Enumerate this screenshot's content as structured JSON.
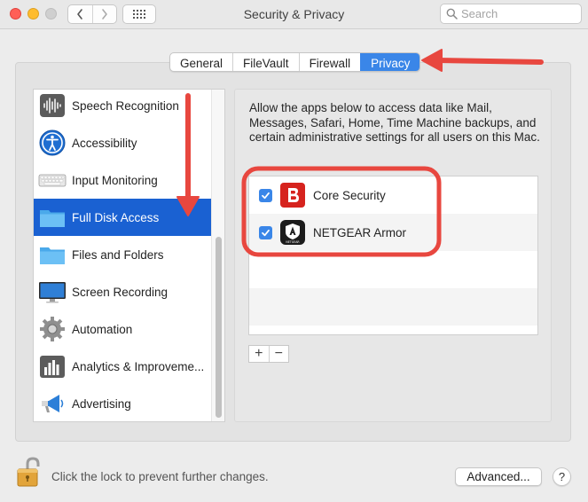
{
  "window": {
    "title": "Security & Privacy",
    "search_placeholder": "Search"
  },
  "tabs": [
    {
      "label": "General",
      "active": false
    },
    {
      "label": "FileVault",
      "active": false
    },
    {
      "label": "Firewall",
      "active": false
    },
    {
      "label": "Privacy",
      "active": true
    }
  ],
  "sidebar": {
    "items": [
      {
        "label": "Speech Recognition",
        "icon": "speech-recognition-icon",
        "selected": false
      },
      {
        "label": "Accessibility",
        "icon": "accessibility-icon",
        "selected": false
      },
      {
        "label": "Input Monitoring",
        "icon": "keyboard-icon",
        "selected": false
      },
      {
        "label": "Full Disk Access",
        "icon": "folder-icon",
        "selected": true
      },
      {
        "label": "Files and Folders",
        "icon": "folder-icon",
        "selected": false
      },
      {
        "label": "Screen Recording",
        "icon": "display-icon",
        "selected": false
      },
      {
        "label": "Automation",
        "icon": "gear-icon",
        "selected": false
      },
      {
        "label": "Analytics & Improveme...",
        "icon": "bar-chart-icon",
        "selected": false
      },
      {
        "label": "Advertising",
        "icon": "megaphone-icon",
        "selected": false
      }
    ]
  },
  "main": {
    "description": "Allow the apps below to access data like Mail, Messages, Safari, Home, Time Machine backups, and certain administrative settings for all users on this Mac.",
    "apps": [
      {
        "name": "Core Security",
        "checked": true,
        "icon": "core-security-icon"
      },
      {
        "name": "NETGEAR Armor",
        "checked": true,
        "icon": "netgear-armor-icon"
      }
    ],
    "add_label": "+",
    "remove_label": "−",
    "netgear_icon_text": "NETGEAR"
  },
  "footer": {
    "lock_text": "Click the lock to prevent further changes.",
    "advanced_label": "Advanced...",
    "help_label": "?"
  },
  "colors": {
    "accent": "#3a86e8",
    "selection": "#1a61d2",
    "annotation": "#e8473f"
  }
}
